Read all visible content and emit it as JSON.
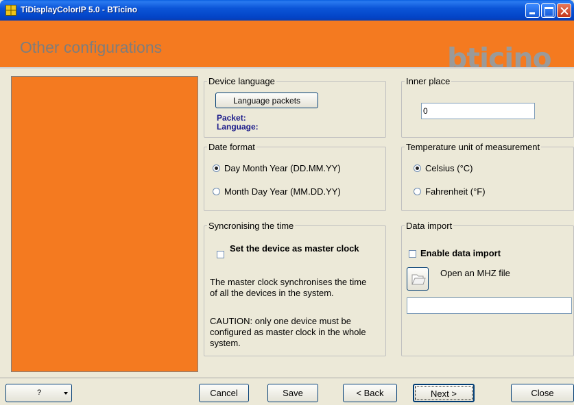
{
  "window": {
    "title": "TiDisplayColorIP 5.0 - BTicino"
  },
  "header": {
    "title": "Other configurations",
    "logo": "bticino"
  },
  "device_language": {
    "legend": "Device language",
    "button": "Language packets",
    "packet_label": "Packet:",
    "language_label": "Language:"
  },
  "inner_place": {
    "legend": "Inner place",
    "value": "0"
  },
  "date_format": {
    "legend": "Date format",
    "options": [
      "Day Month Year (DD.MM.YY)",
      "Month Day Year (MM.DD.YY)"
    ],
    "selected": "Day Month Year (DD.MM.YY)"
  },
  "temperature": {
    "legend": "Temperature unit of measurement",
    "options": [
      "Celsius (°C)",
      "Fahrenheit (°F)"
    ],
    "selected": "Celsius (°C)"
  },
  "sync_time": {
    "legend": "Syncronising the time",
    "checkbox_label": "Set the device as master clock",
    "checked": false,
    "info": "The master clock synchronises the time of all the devices in the system.",
    "caution": "CAUTION: only one device must be configured as master clock in the whole system."
  },
  "data_import": {
    "legend": "Data import",
    "checkbox_label": "Enable data import",
    "checked": false,
    "open_label": "Open an  MHZ file",
    "file_path": ""
  },
  "footer": {
    "help": "?",
    "cancel": "Cancel",
    "save": "Save",
    "back": "< Back",
    "next": "Next >",
    "close": "Close"
  }
}
